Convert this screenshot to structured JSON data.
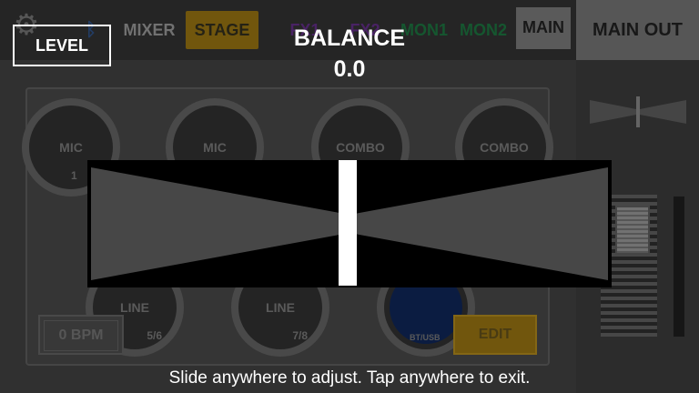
{
  "topbar": {
    "mixer_label": "MIXER",
    "stage_label": "STAGE",
    "fx1_label": "FX1",
    "fx2_label": "FX2",
    "mon1_label": "MON1",
    "mon2_label": "MON2",
    "main_label": "MAIN"
  },
  "side": {
    "main_out_label": "MAIN OUT"
  },
  "channels": [
    {
      "label": "MIC",
      "number": "1"
    },
    {
      "label": "MIC",
      "number": ""
    },
    {
      "label": "COMBO",
      "number": ""
    },
    {
      "label": "COMBO",
      "number": ""
    },
    {
      "label": "LINE",
      "number": "5/6"
    },
    {
      "label": "LINE",
      "number": "7/8"
    },
    {
      "label": "",
      "number": "BT/USB"
    }
  ],
  "bpm_label": "0 BPM",
  "edit_label": "EDIT",
  "overlay": {
    "level_label": "LEVEL",
    "title": "BALANCE",
    "value": "0.0",
    "balance_position": 0.5,
    "hint": "Slide anywhere to adjust. Tap anywhere to exit."
  },
  "colors": {
    "accent_gold": "#8a6a10",
    "fx_purple": "#5a2a7a",
    "mon_green": "#1a6a3a",
    "bt_blue": "#0e2350",
    "balance_fill": "#474747"
  },
  "icons": {
    "settings": "gear-icon",
    "bluetooth": "bluetooth-icon"
  }
}
